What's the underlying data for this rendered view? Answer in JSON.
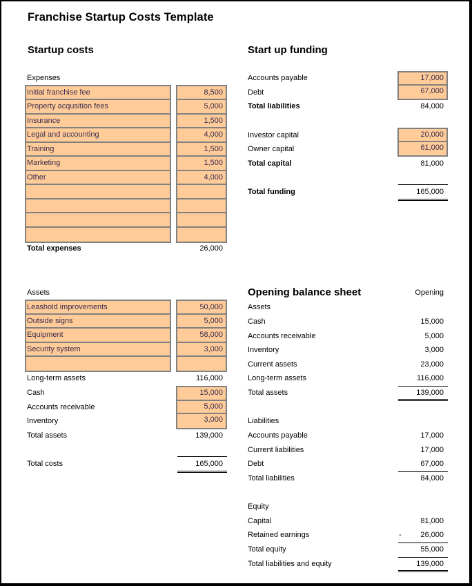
{
  "title": "Franchise Startup Costs Template",
  "colors": {
    "input_fill": "#FFCC99",
    "input_border": "#808080"
  },
  "startup_costs": {
    "heading": "Startup costs",
    "expenses": {
      "label": "Expenses",
      "rows": [
        {
          "name": "Initial franchise fee",
          "value": "8,500"
        },
        {
          "name": "Property acqusition fees",
          "value": "5,000"
        },
        {
          "name": "Insurance",
          "value": "1,500"
        },
        {
          "name": "Legal and accounting",
          "value": "4,000"
        },
        {
          "name": "Training",
          "value": "1,500"
        },
        {
          "name": "Marketing",
          "value": "1,500"
        },
        {
          "name": "Other",
          "value": "4,000"
        },
        {
          "name": "",
          "value": ""
        },
        {
          "name": "",
          "value": ""
        },
        {
          "name": "",
          "value": ""
        },
        {
          "name": "",
          "value": ""
        }
      ],
      "total_label": "Total expenses",
      "total_value": "26,000"
    },
    "assets": {
      "label": "Assets",
      "rows": [
        {
          "name": "Leashold improvements",
          "value": "50,000"
        },
        {
          "name": "Outside signs",
          "value": "5,000"
        },
        {
          "name": "Equipment",
          "value": "58,000"
        },
        {
          "name": "Security system",
          "value": "3,000"
        },
        {
          "name": "",
          "value": ""
        }
      ],
      "long_term_label": "Long-term assets",
      "long_term_value": "116,000",
      "current_rows": [
        {
          "name": "Cash",
          "value": "15,000"
        },
        {
          "name": "Accounts receivable",
          "value": "5,000"
        },
        {
          "name": "Inventory",
          "value": "3,000"
        }
      ],
      "total_label": "Total assets",
      "total_value": "139,000"
    },
    "total_costs_label": "Total costs",
    "total_costs_value": "165,000"
  },
  "funding": {
    "heading": "Start up funding",
    "liabilities": [
      {
        "name": "Accounts payable",
        "value": "17,000"
      },
      {
        "name": "Debt",
        "value": "67,000"
      }
    ],
    "total_liabilities_label": "Total liabilities",
    "total_liabilities_value": "84,000",
    "capital": [
      {
        "name": "Investor capital",
        "value": "20,000"
      },
      {
        "name": "Owner capital",
        "value": "61,000"
      }
    ],
    "total_capital_label": "Total capital",
    "total_capital_value": "81,000",
    "total_funding_label": "Total funding",
    "total_funding_value": "165,000"
  },
  "balance_sheet": {
    "heading": "Opening balance sheet",
    "column_header": "Opening",
    "assets_label": "Assets",
    "assets": [
      {
        "name": "Cash",
        "value": "15,000"
      },
      {
        "name": "Accounts receivable",
        "value": "5,000"
      },
      {
        "name": "Inventory",
        "value": "3,000"
      }
    ],
    "current_assets_label": "Current assets",
    "current_assets_value": "23,000",
    "long_term_label": "Long-term assets",
    "long_term_value": "116,000",
    "total_assets_label": "Total assets",
    "total_assets_value": "139,000",
    "liabilities_label": "Liabilities",
    "accounts_payable_label": "Accounts payable",
    "accounts_payable_value": "17,000",
    "current_liabilities_label": "Current liabilities",
    "current_liabilities_value": "17,000",
    "debt_label": "Debt",
    "debt_value": "67,000",
    "total_liabilities_label": "Total liabilities",
    "total_liabilities_value": "84,000",
    "equity_label": "Equity",
    "capital_label": "Capital",
    "capital_value": "81,000",
    "retained_label": "Retained earnings",
    "retained_sign": "-",
    "retained_value": "26,000",
    "total_equity_label": "Total equity",
    "total_equity_value": "55,000",
    "total_le_label": "Total liabilities and equity",
    "total_le_value": "139,000"
  }
}
